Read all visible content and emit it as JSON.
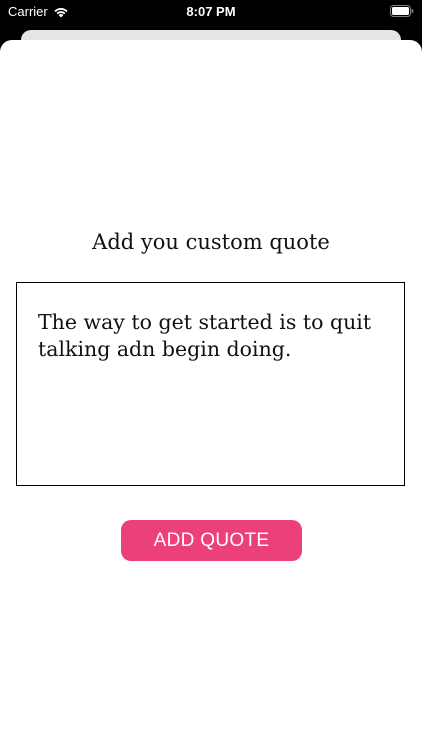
{
  "status_bar": {
    "carrier": "Carrier",
    "time": "8:07 PM",
    "wifi_icon": "wifi-icon",
    "battery_icon": "battery-icon"
  },
  "screen": {
    "title": "Add you custom quote",
    "quote_text": "The way to get started is to quit talking adn begin doing.",
    "add_button_label": "ADD QUOTE"
  },
  "colors": {
    "accent": "#ec407a",
    "background": "#ffffff",
    "status_bar_bg": "#000000"
  }
}
